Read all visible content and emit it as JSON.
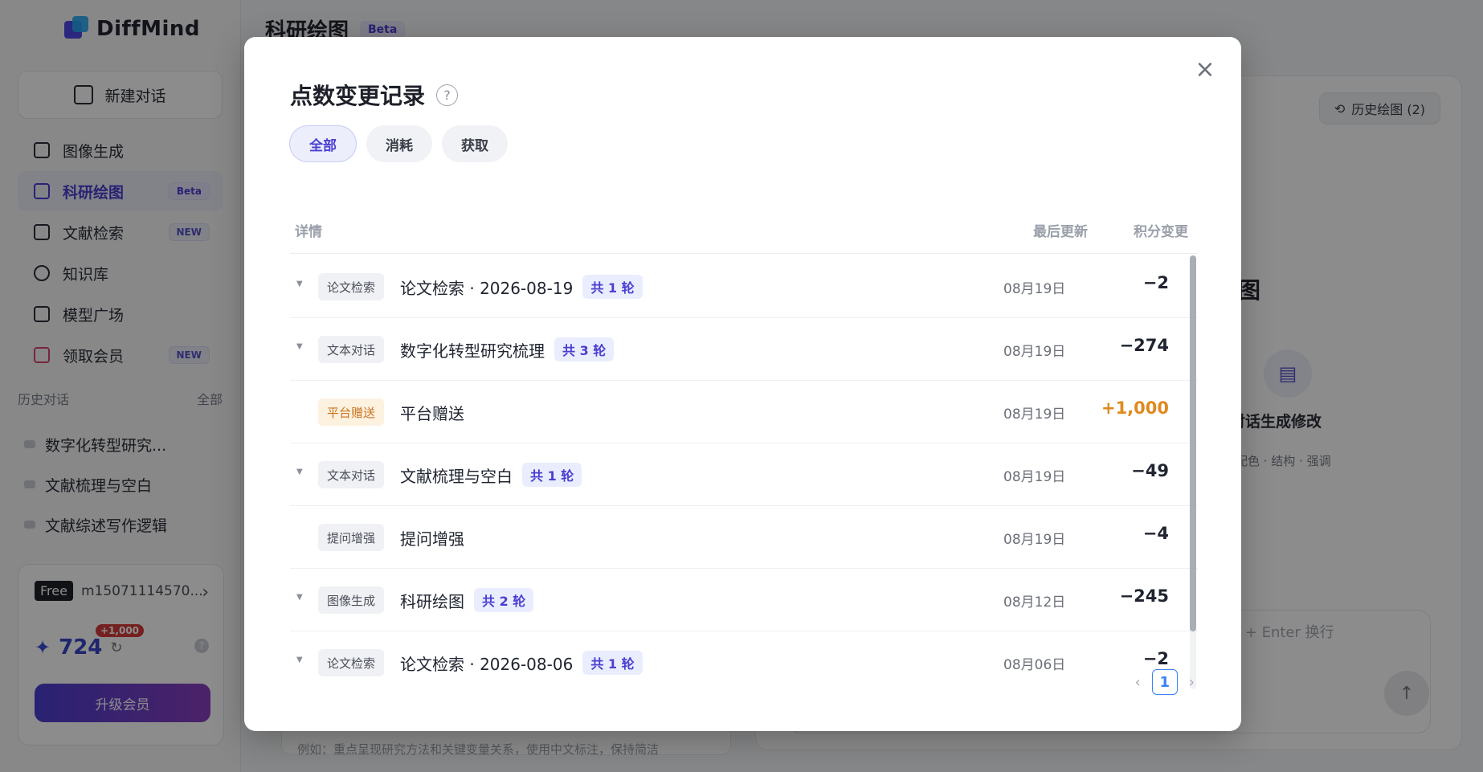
{
  "app": {
    "logo_text": "DiffMind"
  },
  "sidebar": {
    "new_chat_label": "新建对话",
    "items": [
      {
        "label": "图像生成",
        "badge": ""
      },
      {
        "label": "科研绘图",
        "badge": "Beta"
      },
      {
        "label": "文献检索",
        "badge": "NEW"
      },
      {
        "label": "知识库",
        "badge": ""
      },
      {
        "label": "模型广场",
        "badge": ""
      },
      {
        "label": "领取会员",
        "badge": "NEW"
      }
    ],
    "history_title": "历史对话",
    "history_all": "全部",
    "history": [
      "数字化转型研究...",
      "文献梳理与空白",
      "文献综述写作逻辑"
    ],
    "account": {
      "plan": "Free",
      "username": "m15071114570...",
      "points": "724",
      "points_bonus": "+1,000",
      "upgrade_label": "升级会员"
    }
  },
  "main": {
    "title": "科研绘图",
    "title_badge": "Beta",
    "history_button": "历史绘图 (2)",
    "heading_partial": "图",
    "feature_title": "对话生成修改",
    "feature_sub": "配色 · 结构 · 强调",
    "input_placeholder": "t + Enter 换行",
    "example_text": "例如：重点呈现研究方法和关键变量关系，使用中文标注，保持简洁"
  },
  "modal": {
    "title": "点数变更记录",
    "help": "?",
    "tabs": [
      "全部",
      "消耗",
      "获取"
    ],
    "active_tab": "全部",
    "columns": {
      "detail": "详情",
      "updated": "最后更新",
      "change": "积分变更"
    },
    "rows": [
      {
        "has_caret": true,
        "tag": "论文检索",
        "title": "论文检索 · 2026-08-19",
        "rounds": "共 1 轮",
        "date": "08月19日",
        "amount": "−2",
        "positive": false
      },
      {
        "has_caret": true,
        "tag": "文本对话",
        "title": "数字化转型研究梳理",
        "rounds": "共 3 轮",
        "date": "08月19日",
        "amount": "−274",
        "positive": false
      },
      {
        "has_caret": false,
        "tag": "平台赠送",
        "title": "平台赠送",
        "rounds": "",
        "date": "08月19日",
        "amount": "+1,000",
        "positive": true
      },
      {
        "has_caret": true,
        "tag": "文本对话",
        "title": "文献梳理与空白",
        "rounds": "共 1 轮",
        "date": "08月19日",
        "amount": "−49",
        "positive": false
      },
      {
        "has_caret": false,
        "tag": "提问增强",
        "title": "提问增强",
        "rounds": "",
        "date": "08月19日",
        "amount": "−4",
        "positive": false
      },
      {
        "has_caret": true,
        "tag": "图像生成",
        "title": "科研绘图",
        "rounds": "共 2 轮",
        "date": "08月12日",
        "amount": "−245",
        "positive": false
      },
      {
        "has_caret": true,
        "tag": "论文检索",
        "title": "论文检索 · 2026-08-06",
        "rounds": "共 1 轮",
        "date": "08月06日",
        "amount": "−2",
        "positive": false
      }
    ],
    "pagination": {
      "current": "1",
      "prev": "‹",
      "next": "›"
    }
  }
}
